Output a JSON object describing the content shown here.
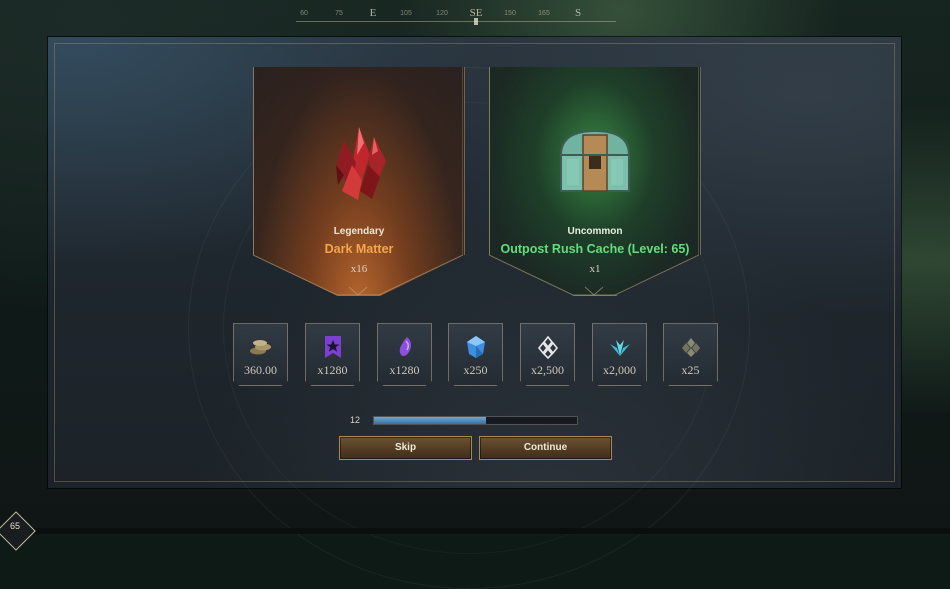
{
  "compass": {
    "ticks": [
      "60",
      "75",
      "105",
      "120",
      "150",
      "165"
    ],
    "directions": [
      "E",
      "SE",
      "S"
    ]
  },
  "rewards": [
    {
      "rarity": "Legendary",
      "name": "Dark Matter",
      "quantity": "x16",
      "icon": "crystal-icon",
      "rarity_color": "#f4a64a"
    },
    {
      "rarity": "Uncommon",
      "name": "Outpost Rush Cache (Level: 65)",
      "quantity": "x1",
      "icon": "chest-icon",
      "rarity_color": "#5fe07a"
    }
  ],
  "currencies": [
    {
      "icon": "coins-icon",
      "value": "360.00"
    },
    {
      "icon": "faction-token-icon",
      "value": "x1280"
    },
    {
      "icon": "azoth-icon",
      "value": "x1280"
    },
    {
      "icon": "gem-shard-icon",
      "value": "x250"
    },
    {
      "icon": "reputation-icon",
      "value": "x2,500"
    },
    {
      "icon": "crystal-flower-icon",
      "value": "x2,000"
    },
    {
      "icon": "mark-icon",
      "value": "x25"
    }
  ],
  "timer": {
    "seconds": "12",
    "progress": 0.55
  },
  "buttons": {
    "skip": "Skip",
    "continue": "Continue"
  },
  "player": {
    "level": "65"
  }
}
